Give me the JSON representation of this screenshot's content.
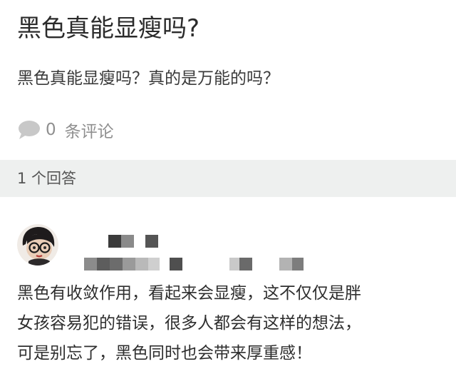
{
  "question": {
    "title": "黑色真能显瘦吗?",
    "body": "黑色真能显瘦吗？真的是万能的吗？",
    "comment_count": "0",
    "comment_label": "条评论"
  },
  "answers_header": "1 个回答",
  "answer": {
    "avatar_icon": "cartoon-character-avatar-icon",
    "author_name_pixelated": true,
    "author_bio_pixelated": true,
    "lines": [
      "黑色有收敛作用，看起来会显瘦，这不仅仅是胖",
      "女孩容易犯的错误，很多人都会有这样的想法，",
      "可是别忘了，黑色同时也会带来厚重感！"
    ]
  },
  "colors": {
    "background": "#ffffff",
    "divider_bar": "#eef0ef",
    "muted_text": "#8f8f8f",
    "comment_icon": "#c8c8c8"
  }
}
